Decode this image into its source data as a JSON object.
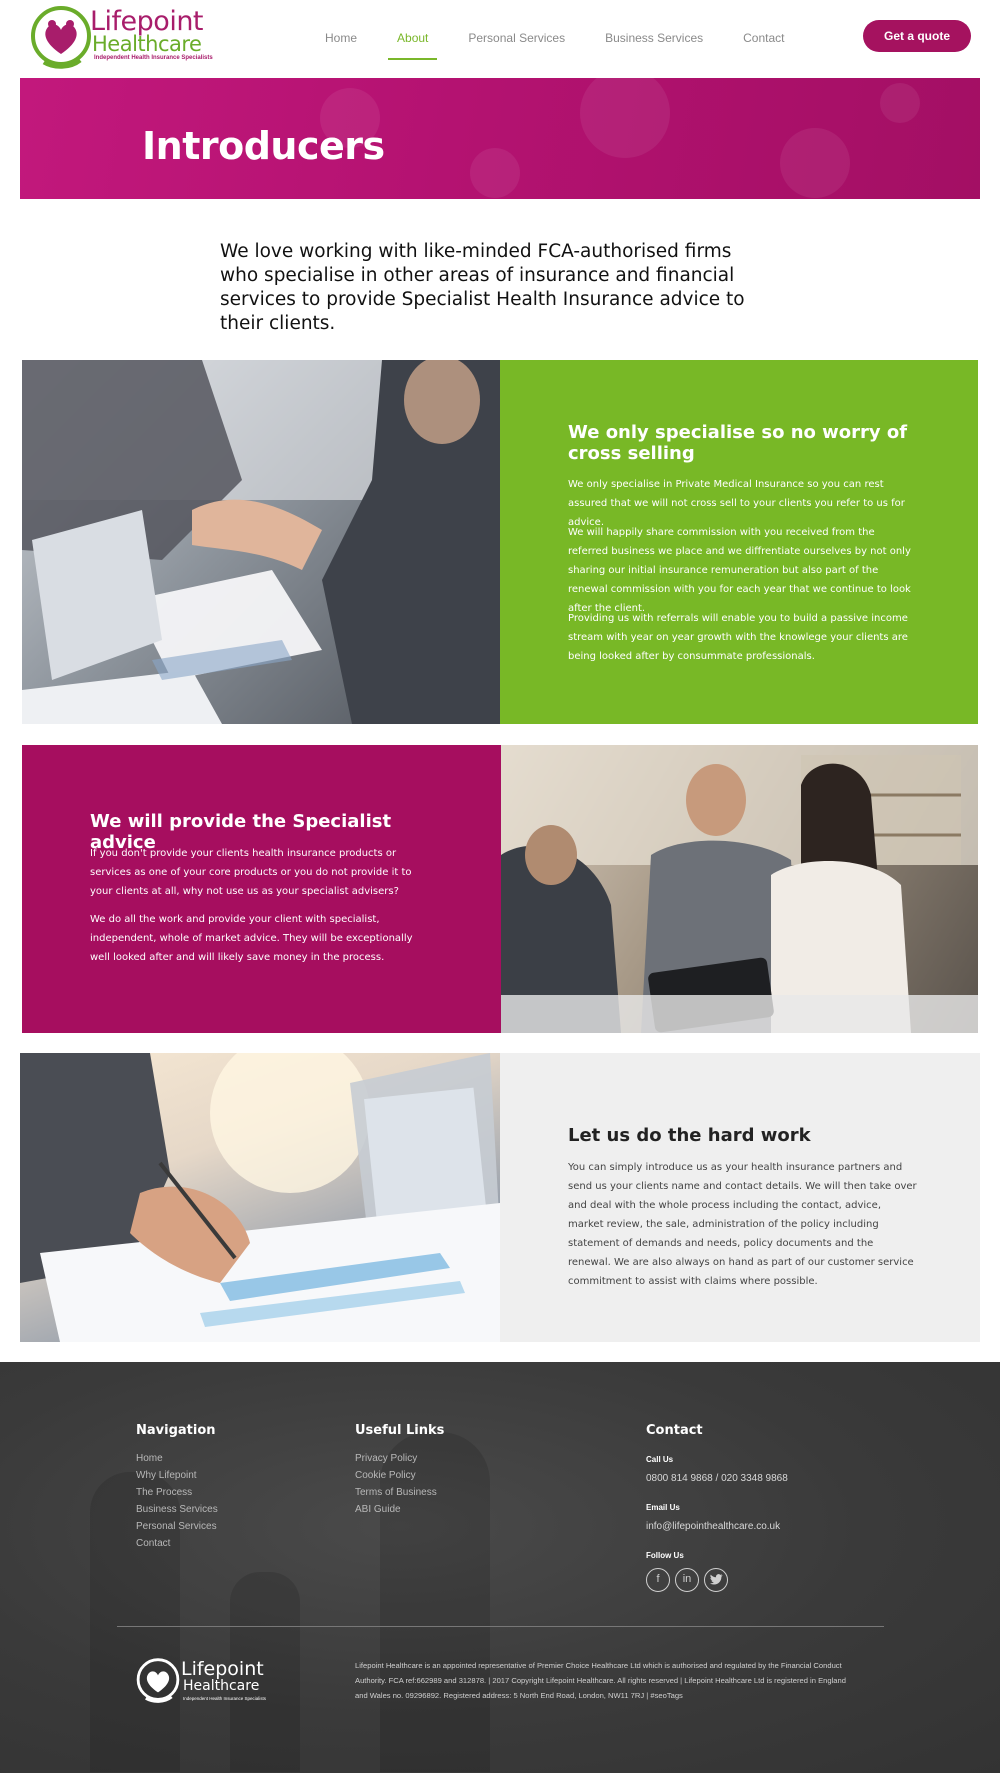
{
  "header": {
    "logo": {
      "brand_line1": "Lifepoint",
      "brand_line2": "Healthcare",
      "tagline": "Independent Health Insurance Specialists"
    },
    "nav": [
      {
        "label": "Home",
        "active": false
      },
      {
        "label": "About",
        "active": true
      },
      {
        "label": "Personal Services",
        "active": false
      },
      {
        "label": "Business Services",
        "active": false
      },
      {
        "label": "Contact",
        "active": false
      }
    ],
    "cta_label": "Get a quote"
  },
  "hero": {
    "title": "Introducers"
  },
  "intro": "We love working with like-minded FCA-authorised firms who specialise in other areas of insurance and financial services to provide Specialist Health Insurance advice to their clients.",
  "sections": {
    "cross_selling": {
      "heading": "We only specialise so no worry of cross selling",
      "paragraphs": [
        "We only specialise in Private Medical Insurance so you can rest assured that we will not cross sell to your clients you refer to us for advice.",
        "We will happily share commission with you received from the referred business we place and we diffrentiate ourselves by not only sharing our initial insurance remuneration but also part of the renewal commission with you for each year that we continue to look after the client.",
        "Providing us with referrals will enable you to build a passive income stream with year on year growth with the knowlege your clients are being looked after by consummate professionals."
      ]
    },
    "specialist_advice": {
      "heading": "We will provide the Specialist advice",
      "paragraphs": [
        "If you don't provide your clients health insurance products or services as one of your core products or you do not provide it to your clients at all, why not use us as your specialist advisers?",
        "We do all the work and provide your client with specialist, independent, whole of market advice. They will be exceptionally well looked after and will likely save money in the process."
      ]
    },
    "hard_work": {
      "heading": "Let us do the hard work",
      "paragraphs": [
        "You can simply introduce us as your health insurance partners and send us your clients name and contact details. We will then take over and deal with the whole process including the contact, advice, market review, the sale, administration of the policy including statement of demands and needs, policy documents and the renewal. We are also always on hand as part of our customer service commitment to assist with claims where possible."
      ]
    }
  },
  "footer": {
    "navigation": {
      "title": "Navigation",
      "links": [
        "Home",
        "Why Lifepoint",
        "The Process",
        "Business Services",
        "Personal Services",
        "Contact"
      ]
    },
    "useful_links": {
      "title": "Useful Links",
      "links": [
        "Privacy Policy",
        "Cookie Policy",
        "Terms of Business",
        "ABI Guide"
      ]
    },
    "contact": {
      "title": "Contact",
      "call_label": "Call Us",
      "phone": "0800 814 9868 / 020 3348 9868",
      "email_label": "Email Us",
      "email": "info@lifepointhealthcare.co.uk",
      "follow_label": "Follow Us",
      "social": [
        "facebook-icon",
        "linkedin-icon",
        "twitter-icon"
      ]
    },
    "logo": {
      "brand_line1": "Lifepoint",
      "brand_line2": "Healthcare",
      "tagline": "Independent Health Insurance Specialists"
    },
    "legal": "Lifepoint Healthcare is an appointed representative of Premier Choice Healthcare Ltd which is authorised and regulated by the Financial Conduct Authority. FCA ref:662989 and 312878. | 2017 Copyright Lifepoint Healthcare. All rights reserved | Lifepoint Healthcare Ltd is registered in England and Wales no. 09296892. Registered address: 5 North End Road, London, NW11 7RJ | #seoTags"
  },
  "colors": {
    "magenta": "#a60e5f",
    "green": "#78b826",
    "grey_panel": "#efefef",
    "footer_bg": "#3a3a3a"
  }
}
